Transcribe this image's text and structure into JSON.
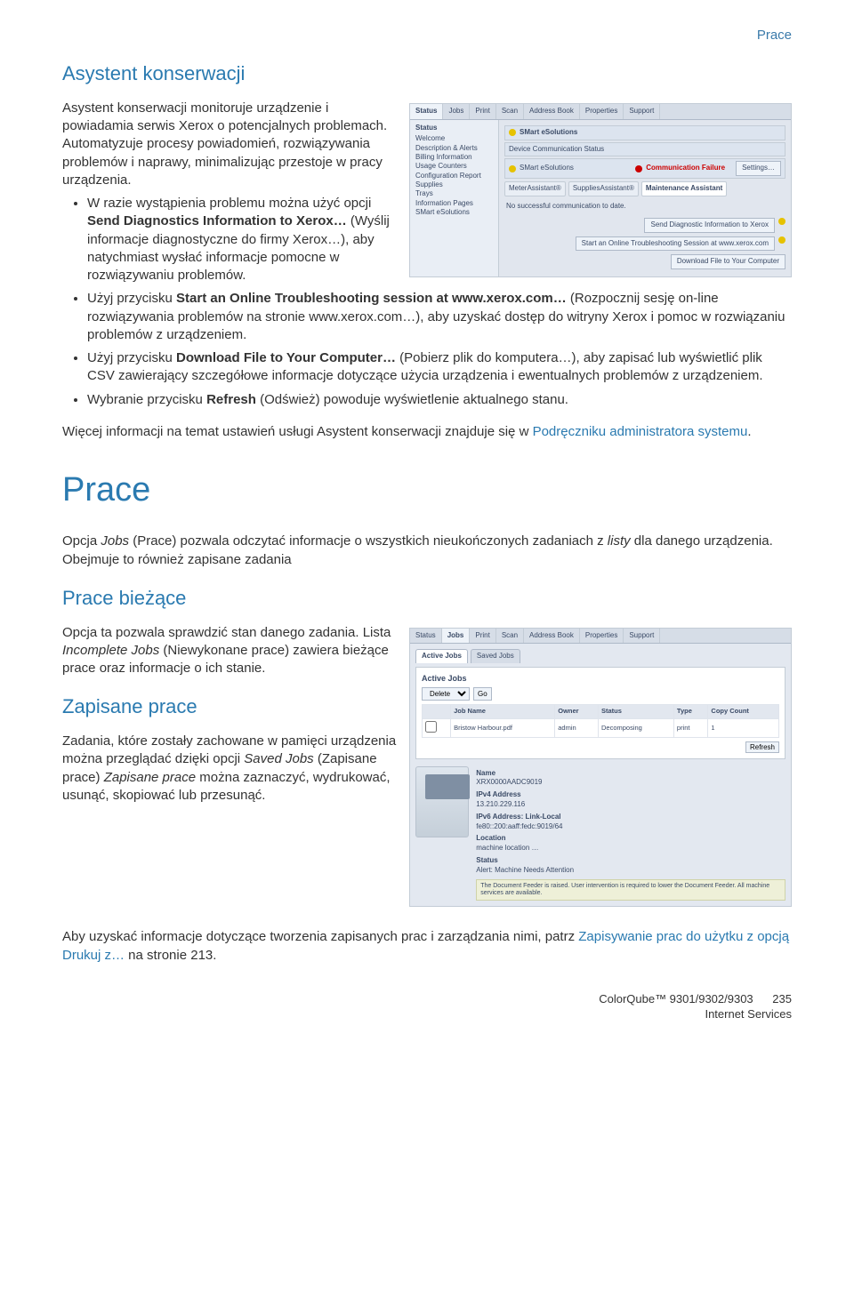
{
  "page_label": "Prace",
  "h_asystent": "Asystent konserwacji",
  "intro1": "Asystent konserwacji monitoruje urządzenie i powiadamia serwis Xerox o potencjalnych problemach. Automatyzuje procesy powiadomień, rozwiązywania problemów i naprawy, minimalizując przestoje w pracy urządzenia.",
  "bullets1": {
    "a_pre": "W razie wystąpienia problemu można użyć opcji ",
    "a_bold": "Send Diagnostics Information to Xerox…",
    "a_post": " (Wyślij informacje diagnostyczne do firmy Xerox…), aby natychmiast wysłać informacje pomocne w rozwiązywaniu problemów.",
    "b_pre": "Użyj przycisku ",
    "b_bold": "Start an Online Troubleshooting session at www.xerox.com…",
    "b_post": " (Rozpocznij sesję on-line rozwiązywania problemów na stronie www.xerox.com…), aby uzyskać dostęp do witryny Xerox i pomoc w rozwiązaniu problemów z urządzeniem.",
    "c_pre": "Użyj przycisku ",
    "c_bold": "Download File to Your Computer…",
    "c_post": " (Pobierz plik do komputera…), aby zapisać lub wyświetlić plik CSV zawierający szczegółowe informacje dotyczące użycia urządzenia i ewentualnych problemów z urządzeniem.",
    "d_pre": "Wybranie przycisku ",
    "d_bold": "Refresh",
    "d_post": " (Odśwież) powoduje wyświetlenie aktualnego stanu."
  },
  "more_info_pre": "Więcej informacji na temat ustawień usługi Asystent konserwacji znajduje się w ",
  "more_info_link": "Podręczniku administratora systemu",
  "more_info_post": ".",
  "h_prace": "Prace",
  "prace_intro_a": "Opcja ",
  "prace_intro_jobs": "Jobs",
  "prace_intro_b": " (Prace) pozwala odczytać informacje o wszystkich nieukończonych zadaniach z ",
  "prace_intro_listy": "listy",
  "prace_intro_c": " dla danego urządzenia. Obejmuje to również zapisane zadania",
  "h_biezace": "Prace bieżące",
  "biezace_p_a": "Opcja ta pozwala sprawdzić stan danego zadania. Lista ",
  "biezace_p_it": "Incomplete Jobs",
  "biezace_p_b": " (Niewykonane prace) zawiera bieżące prace oraz informacje o ich stanie.",
  "h_zapisane": "Zapisane prace",
  "zapisane_p_a": "Zadania, które zostały zachowane w pamięci urządzenia można przeglądać dzięki opcji ",
  "zapisane_p_it1": "Saved Jobs",
  "zapisane_p_b": " (Zapisane prace) ",
  "zapisane_p_it2": "Zapisane prace",
  "zapisane_p_c": " można zaznaczyć, wydrukować, usunąć, skopiować lub przesunąć.",
  "final_a": "Aby uzyskać informacje dotyczące tworzenia zapisanych prac i zarządzania nimi, patrz ",
  "final_link": "Zapisywanie prac do użytku z opcją Drukuj z…",
  "final_b": " na stronie 213.",
  "footer": {
    "model": "ColorQube™ 9301/9302/9303",
    "svc": "Internet Services",
    "page": "235"
  },
  "shot1": {
    "tabs": [
      "Status",
      "Jobs",
      "Print",
      "Scan",
      "Address Book",
      "Properties",
      "Support"
    ],
    "side_hdr": "Status",
    "side_items": [
      "Welcome",
      "Description & Alerts",
      "Billing Information",
      "Usage Counters",
      "Configuration Report",
      "Supplies",
      "Trays",
      "Information Pages",
      "SMart eSolutions"
    ],
    "main_title": "SMart eSolutions",
    "comm_label": "Device Communication Status",
    "esol_label": "SMart eSolutions",
    "comm_fail": "Communication Failure",
    "settings_btn": "Settings…",
    "sub_items": [
      "MeterAssistant®",
      "SuppliesAssistant®",
      "Maintenance Assistant"
    ],
    "no_data": "No successful communication to date.",
    "btn1": "Send Diagnostic Information to Xerox",
    "btn2": "Start an Online Troubleshooting Session at www.xerox.com",
    "btn3": "Download File to Your Computer"
  },
  "shot2": {
    "tabs": [
      "Status",
      "Jobs",
      "Print",
      "Scan",
      "Address Book",
      "Properties",
      "Support"
    ],
    "subtabs": [
      "Active Jobs",
      "Saved Jobs"
    ],
    "panel_title": "Active Jobs",
    "delete_opt": "Delete",
    "go": "Go",
    "cols": [
      "",
      "Job Name",
      "Owner",
      "Status",
      "Type",
      "Copy Count"
    ],
    "row": [
      "",
      "Bristow Harbour.pdf",
      "admin",
      "Decomposing",
      "print",
      "1"
    ],
    "refresh": "Refresh",
    "meta": {
      "name_l": "Name",
      "name_v": "XRX0000AADC9019",
      "ip4_l": "IPv4 Address",
      "ip4_v": "13.210.229.116",
      "ip6_l": "IPv6 Address: Link-Local",
      "ip6_v": "fe80::200:aaff:fedc:9019/64",
      "loc_l": "Location",
      "loc_v": "machine location …",
      "stat_l": "Status",
      "stat_v": "Alert: Machine Needs Attention"
    },
    "alert": "The Document Feeder is raised. User intervention is required to lower the Document Feeder. All machine services are available."
  }
}
